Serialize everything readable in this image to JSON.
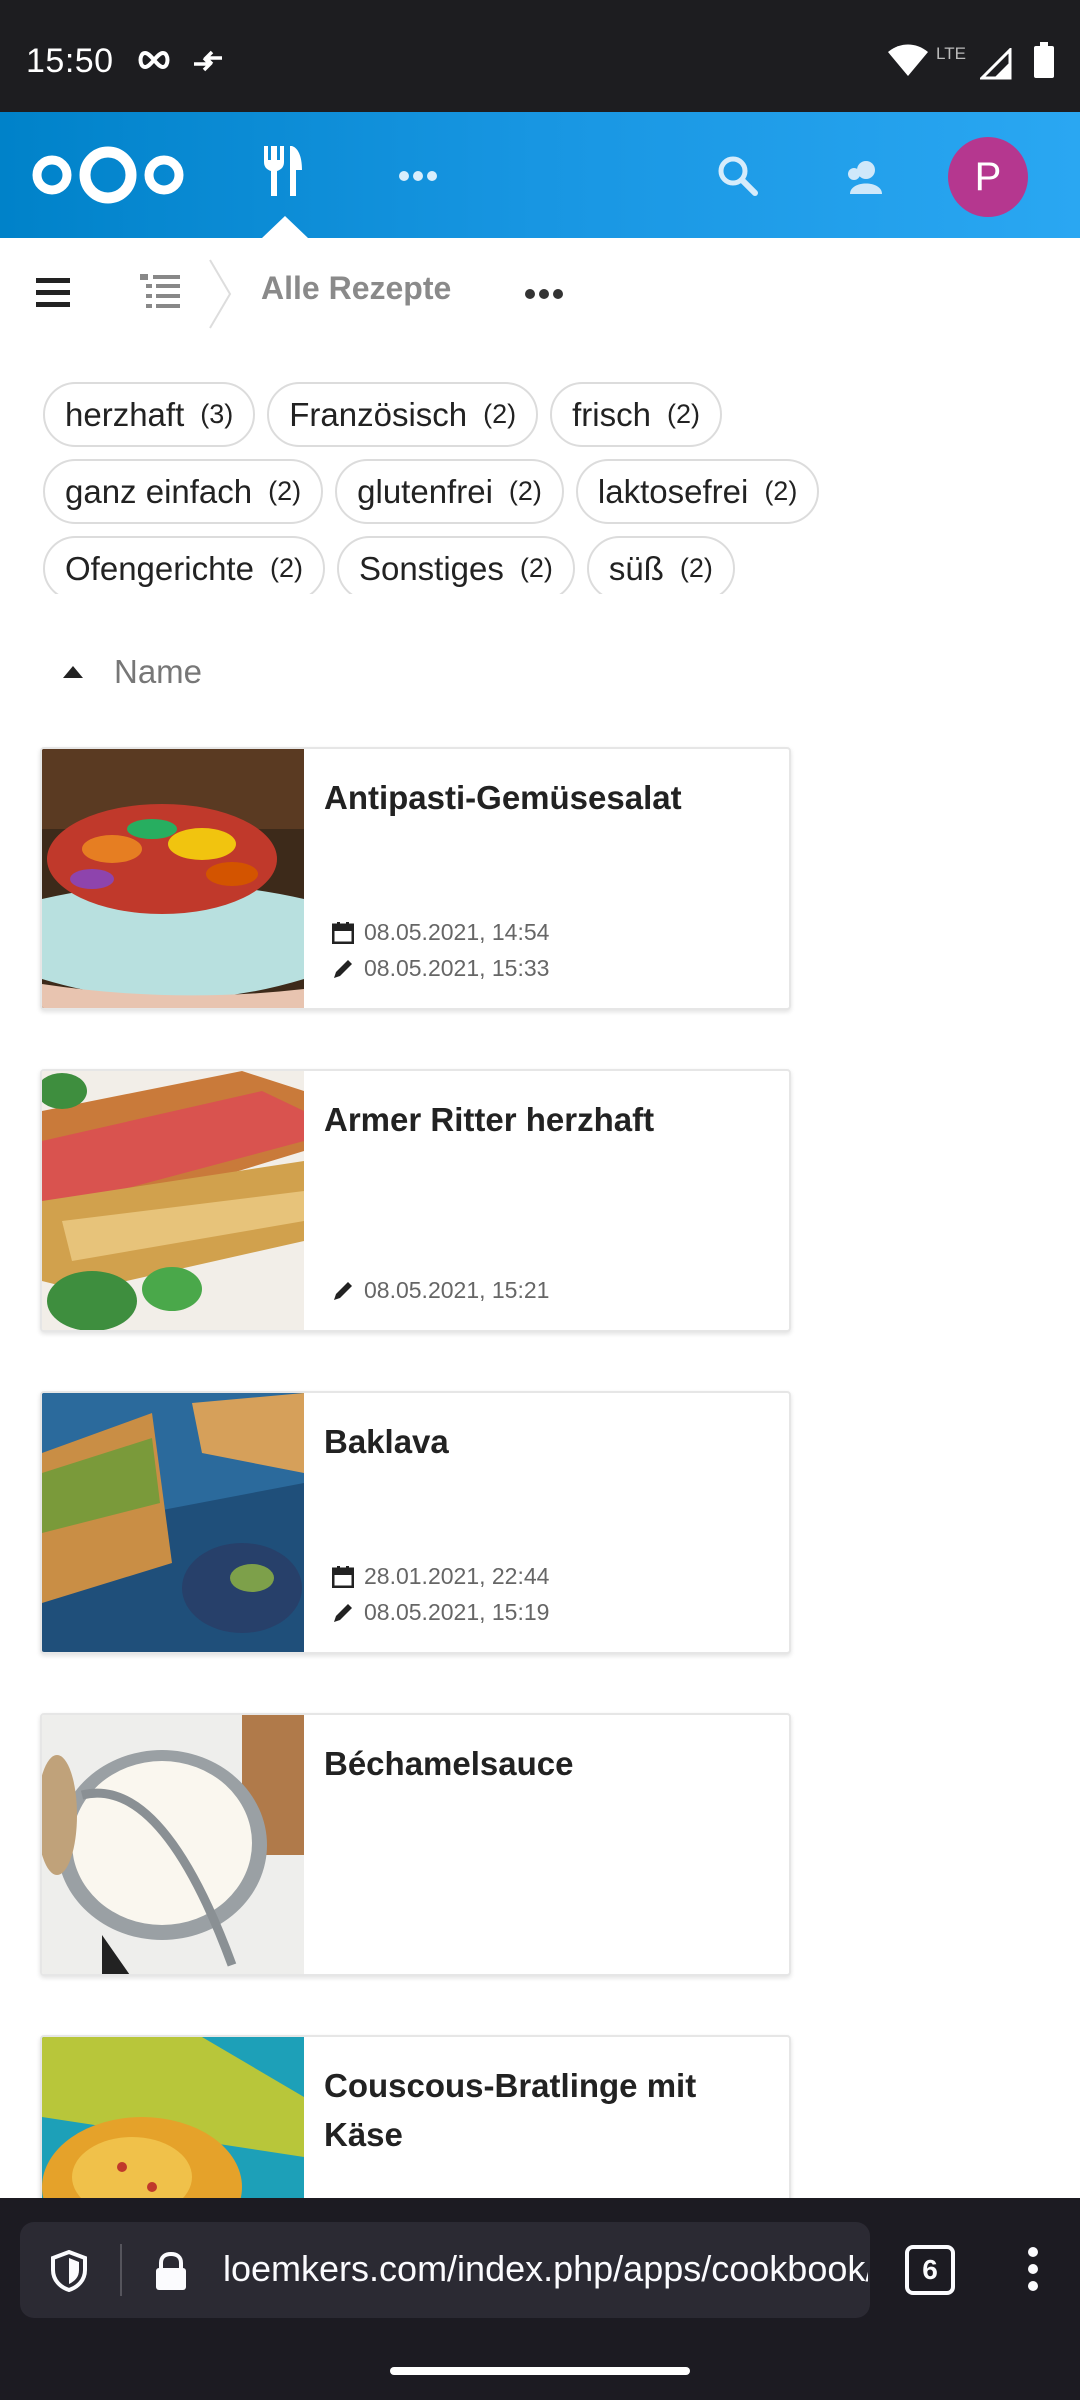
{
  "status_bar": {
    "time": "15:50",
    "network_label": "LTE"
  },
  "header": {
    "logo": "nextcloud-logo",
    "avatar_initial": "P",
    "icons": [
      "cookbook-icon",
      "more-apps-icon",
      "search-icon",
      "contacts-icon"
    ]
  },
  "breadcrumb": {
    "title": "Alle Rezepte"
  },
  "tags": [
    {
      "name": "herzhaft",
      "count": "(3)"
    },
    {
      "name": "Französisch",
      "count": "(2)"
    },
    {
      "name": "frisch",
      "count": "(2)"
    },
    {
      "name": "ganz einfach",
      "count": "(2)"
    },
    {
      "name": "glutenfrei",
      "count": "(2)"
    },
    {
      "name": "laktosefrei",
      "count": "(2)"
    },
    {
      "name": "Ofengerichte",
      "count": "(2)"
    },
    {
      "name": "Sonstiges",
      "count": "(2)"
    },
    {
      "name": "süß",
      "count": "(2)"
    }
  ],
  "sort": {
    "label": "Name"
  },
  "recipes": [
    {
      "title": "Antipasti-Gemüsesalat",
      "created": "08.05.2021, 14:54",
      "modified": "08.05.2021, 15:33"
    },
    {
      "title": "Armer Ritter herzhaft",
      "created": "",
      "modified": "08.05.2021, 15:21"
    },
    {
      "title": "Baklava",
      "created": "28.01.2021, 22:44",
      "modified": "08.05.2021, 15:19"
    },
    {
      "title": "Béchamelsauce",
      "created": "",
      "modified": ""
    },
    {
      "title": "Couscous-Bratlinge mit Käse",
      "created": "",
      "modified": ""
    }
  ],
  "browser": {
    "url": "loemkers.com/index.php/apps/cookbook/",
    "tab_count": "6"
  },
  "colors": {
    "header_start": "#0082c9",
    "header_end": "#2aa7f2",
    "avatar": "#b5378f"
  }
}
